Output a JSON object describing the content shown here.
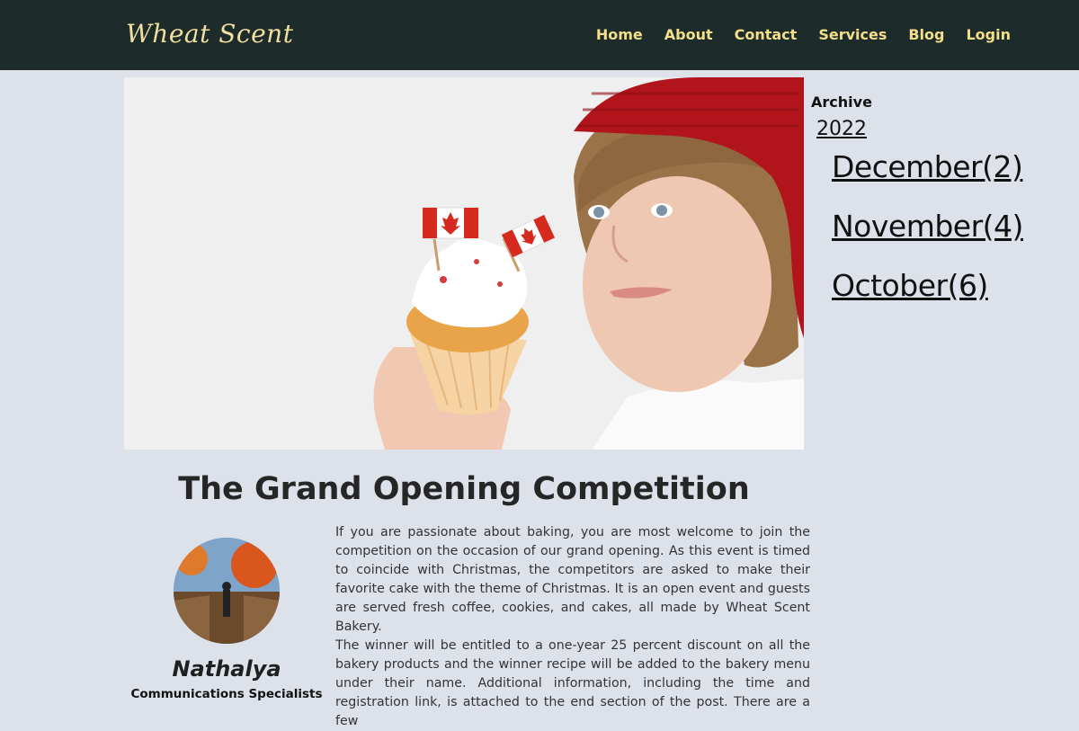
{
  "header": {
    "logo_text": "Wheat Scent",
    "nav": [
      {
        "label": "Home"
      },
      {
        "label": "About"
      },
      {
        "label": "Contact"
      },
      {
        "label": "Services"
      },
      {
        "label": "Blog"
      },
      {
        "label": "Login"
      }
    ]
  },
  "archive": {
    "title": "Archive",
    "year": "2022",
    "months": [
      {
        "label": "December(2)"
      },
      {
        "label": "November(4)"
      },
      {
        "label": "October(6)"
      }
    ]
  },
  "post": {
    "title": "The Grand Opening Competition",
    "author": {
      "name": "Nathalya",
      "role": "Communications Specialists"
    },
    "paragraphs": [
      "If you are passionate about baking, you are most welcome to join the competition on the occasion of our grand opening. As this event is timed to coincide with Christmas, the competitors are asked to make their favorite cake with the theme of Christmas. It is an open event and guests are served fresh coffee, cookies, and cakes, all made by Wheat Scent Bakery.",
      "The winner will be entitled to a one-year 25 percent discount on all the bakery products and the winner recipe will be added to the bakery menu under their name. Additional information, including the time and registration link, is attached to the end section of the post. There are a few"
    ]
  },
  "colors": {
    "header_bg": "#1d2b2b",
    "nav_text": "#f3df8a",
    "page_bg": "#dde2ea"
  }
}
